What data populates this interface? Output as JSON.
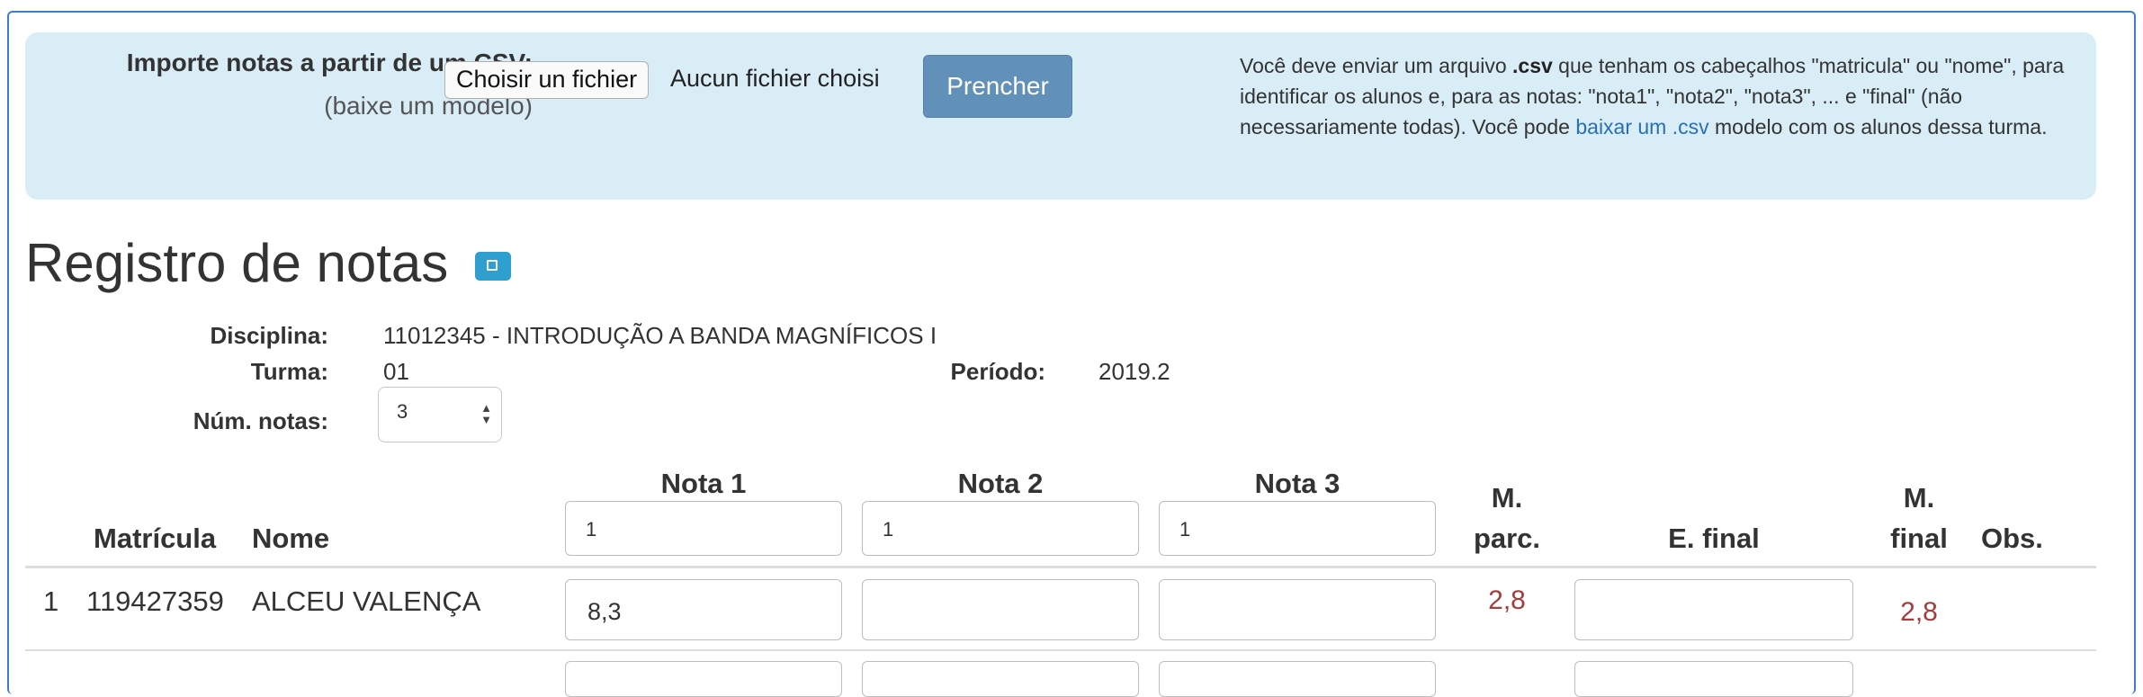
{
  "import": {
    "label": "Importe notas a partir de um CSV:",
    "template_link": "(baixe um modelo)",
    "file_button": "Choisir un fichier",
    "file_status": "Aucun fichier choisi",
    "fill_button": "Prencher",
    "help_part1": "Você deve enviar um arquivo ",
    "help_bold": ".csv",
    "help_part2": " que tenham os cabeçalhos \"matricula\" ou \"nome\", para identificar os alunos e, para as notas: \"nota1\", \"nota2\", \"nota3\", ... e \"final\" (não necessariamente todas). Você pode ",
    "help_link": "baixar um .csv",
    "help_part3": " modelo com os alunos dessa turma."
  },
  "page": {
    "title": "Registro de notas",
    "collapse_icon": "collapse-square-icon"
  },
  "info": {
    "discipline_label": "Disciplina:",
    "discipline_value": "11012345 - INTRODUÇÃO A BANDA MAGNÍFICOS I",
    "class_label": "Turma:",
    "class_value": "01",
    "period_label": "Período:",
    "period_value": "2019.2",
    "num_grades_label": "Núm. notas:",
    "num_grades_value": "3"
  },
  "table": {
    "headers": {
      "matricula": "Matrícula",
      "nome": "Nome",
      "nota1": "Nota 1",
      "nota2": "Nota 2",
      "nota3": "Nota 3",
      "m_parc_1": "M.",
      "m_parc_2": "parc.",
      "e_final": "E. final",
      "m_final_1": "M.",
      "m_final_2": "final",
      "obs": "Obs."
    },
    "weights": [
      "1",
      "1",
      "1"
    ],
    "rows": [
      {
        "index": "1",
        "matricula": "119427359",
        "nome": "ALCEU VALENÇA",
        "nota1": "8,3",
        "nota2": "",
        "nota3": "",
        "m_parc": "2,8",
        "e_final": "",
        "m_final": "2,8",
        "obs": ""
      }
    ]
  },
  "colors": {
    "panel_bg": "#d9edf7",
    "fill_button": "#6190b8",
    "link": "#2a6eb3",
    "failing_grade": "#a53c3c",
    "collapse_icon": "#2f9fcf"
  }
}
